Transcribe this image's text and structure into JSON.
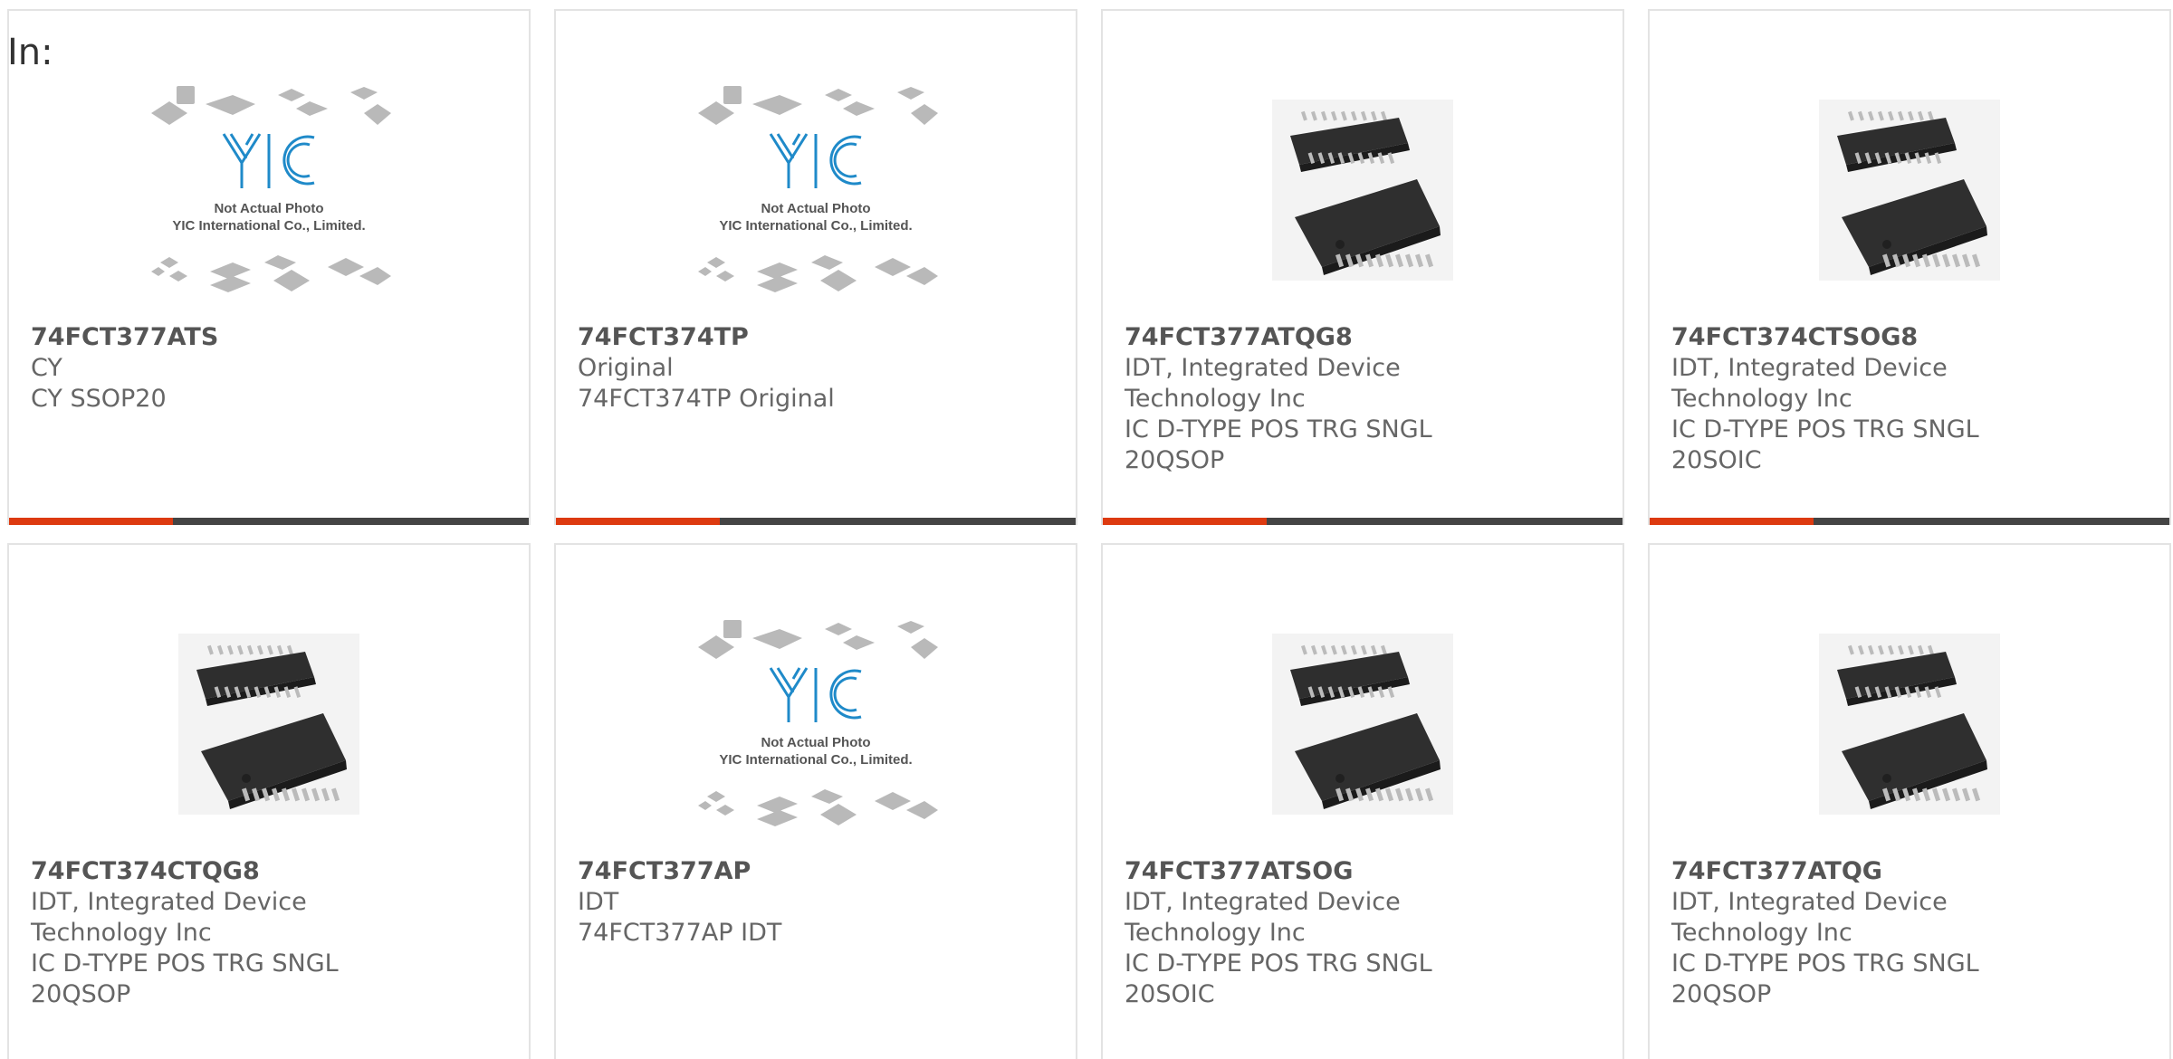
{
  "heading": "In:",
  "placeholder": {
    "logo_text": "YIC",
    "caption_line1": "Not Actual Photo",
    "caption_line2": "YIC International Co., Limited."
  },
  "products": [
    {
      "part": "74FCT377ATS",
      "lines": [
        "CY",
        "CY SSOP20"
      ],
      "image": "yic-placeholder"
    },
    {
      "part": "74FCT374TP",
      "lines": [
        "Original",
        "74FCT374TP Original"
      ],
      "image": "yic-placeholder"
    },
    {
      "part": "74FCT377ATQG8",
      "lines": [
        "IDT, Integrated Device",
        "Technology Inc",
        "IC D-TYPE POS TRG SNGL",
        "20QSOP"
      ],
      "image": "ic-chip-photo"
    },
    {
      "part": "74FCT374CTSOG8",
      "lines": [
        "IDT, Integrated Device",
        "Technology Inc",
        "IC D-TYPE POS TRG SNGL",
        "20SOIC"
      ],
      "image": "ic-chip-photo"
    },
    {
      "part": "74FCT374CTQG8",
      "lines": [
        "IDT, Integrated Device",
        "Technology Inc",
        "IC D-TYPE POS TRG SNGL",
        "20QSOP"
      ],
      "image": "ic-chip-photo"
    },
    {
      "part": "74FCT377AP",
      "lines": [
        "IDT",
        "74FCT377AP IDT"
      ],
      "image": "yic-placeholder"
    },
    {
      "part": "74FCT377ATSOG",
      "lines": [
        "IDT, Integrated Device",
        "Technology Inc",
        "IC D-TYPE POS TRG SNGL",
        "20SOIC"
      ],
      "image": "ic-chip-photo"
    },
    {
      "part": "74FCT377ATQG",
      "lines": [
        "IDT, Integrated Device",
        "Technology Inc",
        "IC D-TYPE POS TRG SNGL",
        "20QSOP"
      ],
      "image": "ic-chip-photo"
    }
  ],
  "colors": {
    "accent": "#dd3a10",
    "bar": "#444444",
    "logo_blue": "#1f8ac9"
  }
}
